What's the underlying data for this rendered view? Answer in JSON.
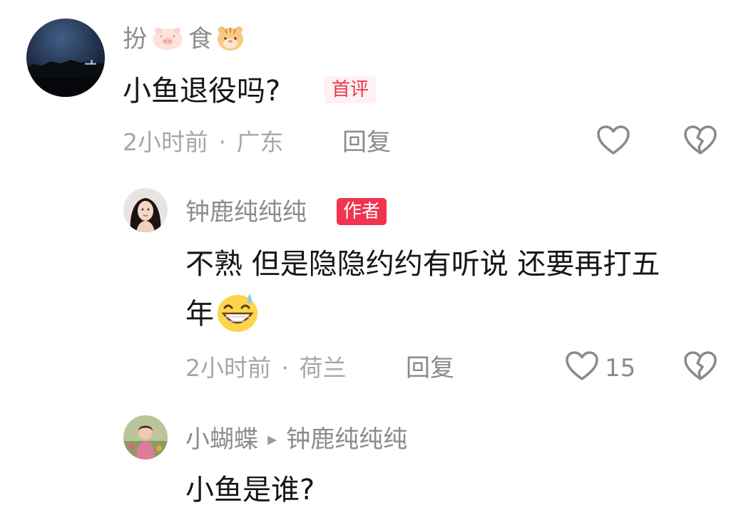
{
  "colors": {
    "username": "#8c8c8c",
    "content": "#161616",
    "meta": "#a7a7a7",
    "author_badge_bg": "#f0334f",
    "first_badge_text": "#e8384f"
  },
  "comments": [
    {
      "username_part1": "扮",
      "username_part2": "食",
      "username_emojis": [
        "pig-face-icon",
        "tiger-face-icon"
      ],
      "text": "小鱼退役吗?",
      "badge": "首评",
      "time": "2小时前",
      "separator": "·",
      "location": "广东",
      "reply_label": "回复",
      "like_icon": "heart-outline-icon",
      "dislike_icon": "broken-heart-icon"
    },
    {
      "username": "钟鹿纯纯纯",
      "badge": "作者",
      "text_line1": "不熟 但是隐隐约约有听说 还要再打五",
      "text_line2": "年",
      "emoji": "grinning-sweat-emoji",
      "time": "2小时前",
      "separator": "·",
      "location": "荷兰",
      "reply_label": "回复",
      "like_count": "15",
      "like_icon": "heart-outline-icon",
      "dislike_icon": "broken-heart-icon"
    },
    {
      "username": "小蝴蝶",
      "reply_arrow": "▸",
      "reply_to": "钟鹿纯纯纯",
      "text": "小鱼是谁?"
    }
  ]
}
